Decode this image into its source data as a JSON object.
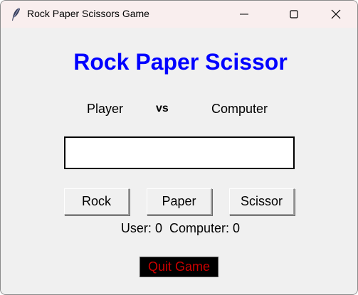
{
  "window": {
    "title": "Rock Paper Scissors Game",
    "icon": "feather-icon",
    "controls": [
      "minimize-icon",
      "maximize-icon",
      "close-icon"
    ]
  },
  "game": {
    "heading": "Rock Paper Scissor",
    "player_label": "Player",
    "vs_label": "vs",
    "computer_label": "Computer",
    "result_text": "",
    "buttons": {
      "rock": "Rock",
      "paper": "Paper",
      "scissor": "Scissor"
    },
    "score": {
      "user_label": "User:",
      "user_value": "0",
      "computer_label": "Computer:",
      "computer_value": "0"
    },
    "quit_label": "Quit Game"
  },
  "colors": {
    "heading": "#0000ff",
    "quit_text": "#cc0000",
    "quit_background": "#000000",
    "window_background": "#f0f0f0",
    "titlebar": "#f9eeee"
  }
}
